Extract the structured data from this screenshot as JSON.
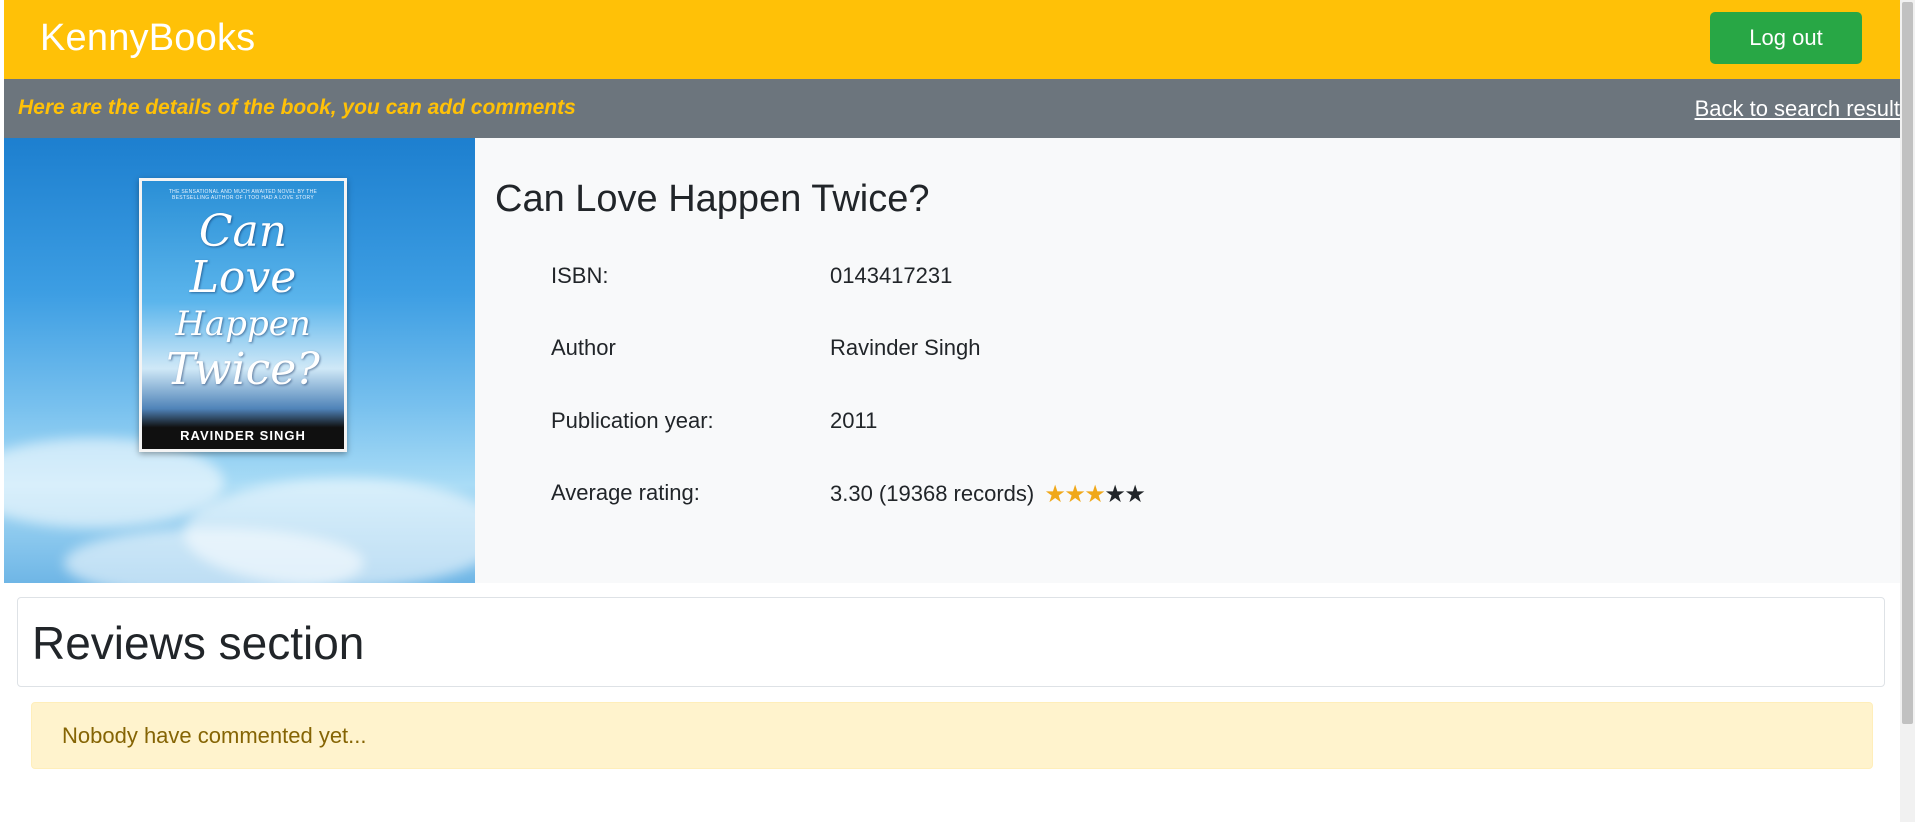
{
  "navbar": {
    "brand": "KennyBooks",
    "logout_label": "Log out"
  },
  "subheader": {
    "message": "Here are the details of the book, you can add comments",
    "back_link": "Back to search result"
  },
  "book": {
    "title": "Can Love Happen Twice?",
    "cover": {
      "blurb": "THE SENSATIONAL AND MUCH AWAITED NOVEL BY THE BESTSELLING AUTHOR OF I TOO HAD A LOVE STORY",
      "title_line1": "Can Love",
      "title_line2": "Happen",
      "title_line3": "Twice?",
      "author": "RAVINDER SINGH"
    },
    "fields": {
      "isbn_label": "ISBN:",
      "isbn": "0143417231",
      "author_label": "Author",
      "author": "Ravinder Singh",
      "year_label": "Publication year:",
      "year": "2011",
      "rating_label": "Average rating:",
      "rating_text": "3.30 (19368 records)",
      "rating_value": 3.3,
      "rating_max": 5
    },
    "star_icon": "star-icon",
    "colors": {
      "star_filled": "#f0a81a",
      "star_empty": "#212529"
    }
  },
  "reviews": {
    "heading": "Reviews section",
    "empty_message": "Nobody have commented yet..."
  },
  "colors": {
    "navbar": "#ffc107",
    "logout_button": "#28a745",
    "subheader": "#6c757d",
    "details_bg": "#f8f9fa",
    "alert_bg": "#fff3cd"
  }
}
